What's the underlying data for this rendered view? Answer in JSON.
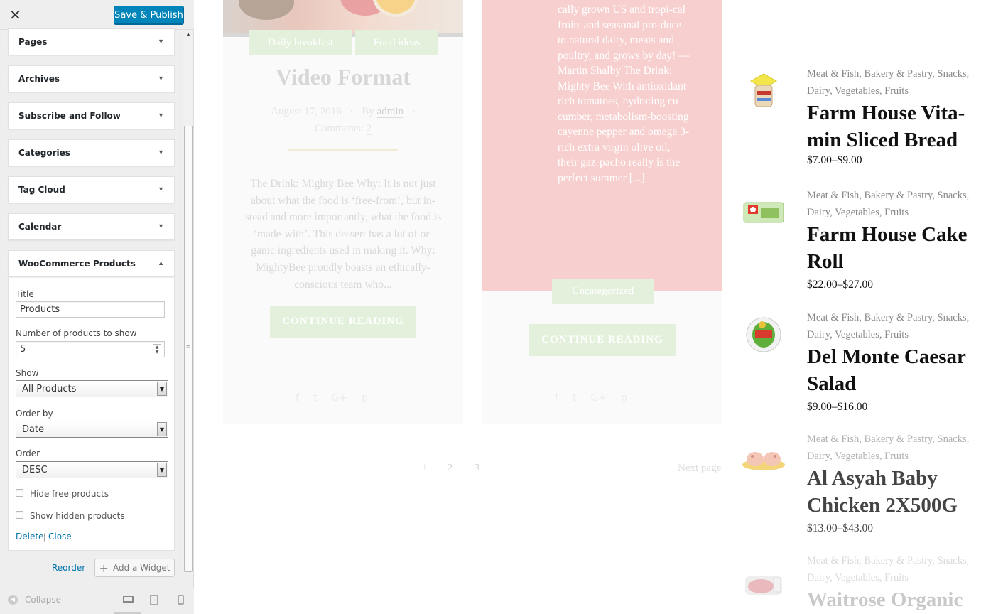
{
  "topbar": {
    "close_glyph": "✕",
    "publish_label": "Save & Publish"
  },
  "widgets": [
    {
      "title": "Pages"
    },
    {
      "title": "Archives"
    },
    {
      "title": "Subscribe and Follow"
    },
    {
      "title": "Categories"
    },
    {
      "title": "Tag Cloud"
    },
    {
      "title": "Calendar"
    },
    {
      "title": "WooCommerce Products"
    }
  ],
  "woo_form": {
    "title_label": "Title",
    "title_value": "Products",
    "number_label": "Number of products to show",
    "number_value": "5",
    "show_label": "Show",
    "show_value": "All Products",
    "orderby_label": "Order by",
    "orderby_value": "Date",
    "order_label": "Order",
    "order_value": "DESC",
    "hide_free_label": "Hide free products",
    "show_hidden_label": "Show hidden products",
    "delete_label": "Delete",
    "separator": "|",
    "close_label": "Close"
  },
  "sidebar_actions": {
    "reorder_label": "Reorder",
    "add_widget_label": "Add a Widget"
  },
  "footer": {
    "collapse_label": "Collapse"
  },
  "preview": {
    "post1": {
      "categories": [
        "Daily breakfast",
        "Food ideas"
      ],
      "title": "Video Format",
      "date": "August 17, 2016",
      "by": "By",
      "author": "admin",
      "comments_label": "Comments:",
      "comments_count": "2",
      "excerpt": "The Drink: Mighty Bee Why: It is not just about what the food is ‘free-from’, but in-stead and more importantly, what the food is ‘made-with’. This dessert has a lot of or-ganic ingredients used in making it. Why: MightyBee proudly boasts an ethically-conscious team who...",
      "button": "CONTINUE READING"
    },
    "post2": {
      "excerpt": "cally grown US and tropi-cal fruits and seasonal pro-duce to natural dairy, meats and poultry, and grows by day! — Martin Shalby The Drink: Mighty Bee With antioxidant-rich tomatoes, hydrating cu-cumber, metabolism-boosting cayenne pepper and omega 3-rich extra virgin olive oil, their gaz-pacho really is the perfect summer [...]",
      "category": "Uncategorized",
      "button": "CONTINUE READING"
    },
    "share_icons": [
      "f",
      "t",
      "G+",
      "p"
    ],
    "pagination": [
      "1",
      "2",
      "3"
    ],
    "next_page": "Next page",
    "products": [
      {
        "categories": "Meat & Fish, Bakery & Pastry, Snacks, Dairy, Vegetables, Fruits",
        "name": "Farm House Vita-min Sliced Bread",
        "price": "$7.00–$9.00",
        "icon": "bread-icon"
      },
      {
        "categories": "Meat & Fish, Bakery & Pastry, Snacks, Dairy, Vegetables, Fruits",
        "name": "Farm House Cake Roll",
        "price": "$22.00–$27.00",
        "icon": "cake-roll-icon"
      },
      {
        "categories": "Meat & Fish, Bakery & Pastry, Snacks, Dairy, Vegetables, Fruits",
        "name": "Del Monte Caesar Salad",
        "price": "$9.00–$16.00",
        "icon": "salad-icon"
      },
      {
        "categories": "Meat & Fish, Bakery & Pastry, Snacks, Dairy, Vegetables, Fruits",
        "name": "Al Asyah Baby Chicken 2X500G",
        "price": "$13.00–$43.00",
        "icon": "chicken-icon"
      },
      {
        "categories": "Meat & Fish, Bakery & Pastry, Snacks, Dairy, Vegetables, Fruits",
        "name": "Waitrose Organic",
        "price": "",
        "icon": "meat-icon"
      }
    ]
  },
  "colors": {
    "publish_blue": "#0085ba",
    "link_blue": "#0073aa",
    "pink_card": "#f7cfcf",
    "tag_green": "#e3f1dc"
  }
}
